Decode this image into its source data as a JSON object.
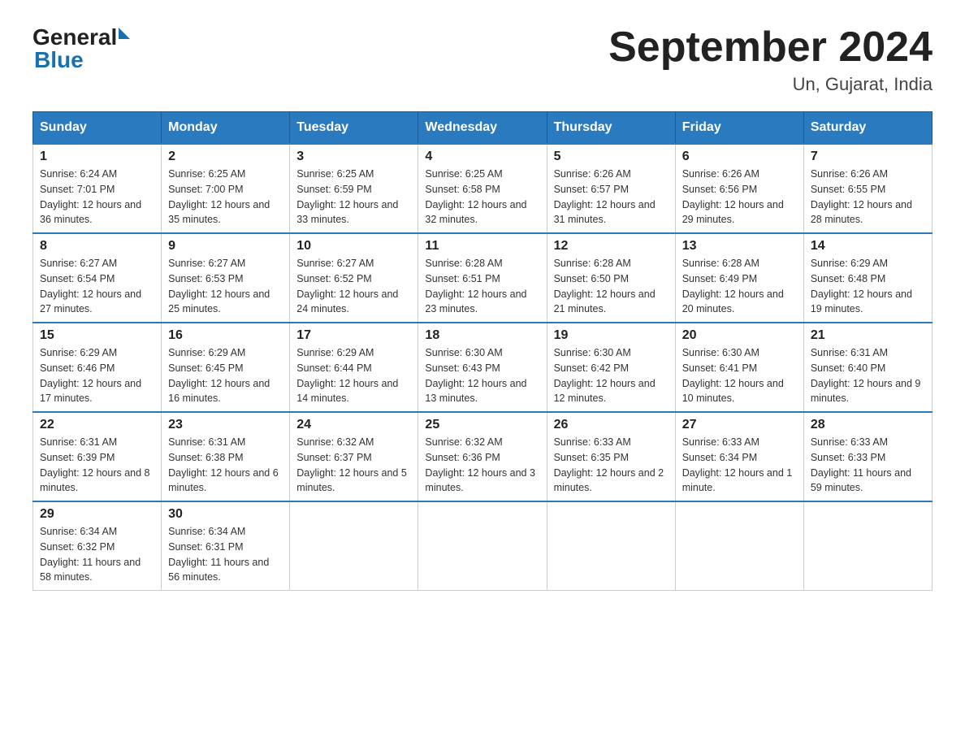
{
  "header": {
    "logo": {
      "text_general": "General",
      "triangle": "▶",
      "text_blue": "Blue"
    },
    "title": "September 2024",
    "location": "Un, Gujarat, India"
  },
  "calendar": {
    "days_of_week": [
      "Sunday",
      "Monday",
      "Tuesday",
      "Wednesday",
      "Thursday",
      "Friday",
      "Saturday"
    ],
    "weeks": [
      [
        {
          "day": "1",
          "sunrise": "6:24 AM",
          "sunset": "7:01 PM",
          "daylight": "12 hours and 36 minutes."
        },
        {
          "day": "2",
          "sunrise": "6:25 AM",
          "sunset": "7:00 PM",
          "daylight": "12 hours and 35 minutes."
        },
        {
          "day": "3",
          "sunrise": "6:25 AM",
          "sunset": "6:59 PM",
          "daylight": "12 hours and 33 minutes."
        },
        {
          "day": "4",
          "sunrise": "6:25 AM",
          "sunset": "6:58 PM",
          "daylight": "12 hours and 32 minutes."
        },
        {
          "day": "5",
          "sunrise": "6:26 AM",
          "sunset": "6:57 PM",
          "daylight": "12 hours and 31 minutes."
        },
        {
          "day": "6",
          "sunrise": "6:26 AM",
          "sunset": "6:56 PM",
          "daylight": "12 hours and 29 minutes."
        },
        {
          "day": "7",
          "sunrise": "6:26 AM",
          "sunset": "6:55 PM",
          "daylight": "12 hours and 28 minutes."
        }
      ],
      [
        {
          "day": "8",
          "sunrise": "6:27 AM",
          "sunset": "6:54 PM",
          "daylight": "12 hours and 27 minutes."
        },
        {
          "day": "9",
          "sunrise": "6:27 AM",
          "sunset": "6:53 PM",
          "daylight": "12 hours and 25 minutes."
        },
        {
          "day": "10",
          "sunrise": "6:27 AM",
          "sunset": "6:52 PM",
          "daylight": "12 hours and 24 minutes."
        },
        {
          "day": "11",
          "sunrise": "6:28 AM",
          "sunset": "6:51 PM",
          "daylight": "12 hours and 23 minutes."
        },
        {
          "day": "12",
          "sunrise": "6:28 AM",
          "sunset": "6:50 PM",
          "daylight": "12 hours and 21 minutes."
        },
        {
          "day": "13",
          "sunrise": "6:28 AM",
          "sunset": "6:49 PM",
          "daylight": "12 hours and 20 minutes."
        },
        {
          "day": "14",
          "sunrise": "6:29 AM",
          "sunset": "6:48 PM",
          "daylight": "12 hours and 19 minutes."
        }
      ],
      [
        {
          "day": "15",
          "sunrise": "6:29 AM",
          "sunset": "6:46 PM",
          "daylight": "12 hours and 17 minutes."
        },
        {
          "day": "16",
          "sunrise": "6:29 AM",
          "sunset": "6:45 PM",
          "daylight": "12 hours and 16 minutes."
        },
        {
          "day": "17",
          "sunrise": "6:29 AM",
          "sunset": "6:44 PM",
          "daylight": "12 hours and 14 minutes."
        },
        {
          "day": "18",
          "sunrise": "6:30 AM",
          "sunset": "6:43 PM",
          "daylight": "12 hours and 13 minutes."
        },
        {
          "day": "19",
          "sunrise": "6:30 AM",
          "sunset": "6:42 PM",
          "daylight": "12 hours and 12 minutes."
        },
        {
          "day": "20",
          "sunrise": "6:30 AM",
          "sunset": "6:41 PM",
          "daylight": "12 hours and 10 minutes."
        },
        {
          "day": "21",
          "sunrise": "6:31 AM",
          "sunset": "6:40 PM",
          "daylight": "12 hours and 9 minutes."
        }
      ],
      [
        {
          "day": "22",
          "sunrise": "6:31 AM",
          "sunset": "6:39 PM",
          "daylight": "12 hours and 8 minutes."
        },
        {
          "day": "23",
          "sunrise": "6:31 AM",
          "sunset": "6:38 PM",
          "daylight": "12 hours and 6 minutes."
        },
        {
          "day": "24",
          "sunrise": "6:32 AM",
          "sunset": "6:37 PM",
          "daylight": "12 hours and 5 minutes."
        },
        {
          "day": "25",
          "sunrise": "6:32 AM",
          "sunset": "6:36 PM",
          "daylight": "12 hours and 3 minutes."
        },
        {
          "day": "26",
          "sunrise": "6:33 AM",
          "sunset": "6:35 PM",
          "daylight": "12 hours and 2 minutes."
        },
        {
          "day": "27",
          "sunrise": "6:33 AM",
          "sunset": "6:34 PM",
          "daylight": "12 hours and 1 minute."
        },
        {
          "day": "28",
          "sunrise": "6:33 AM",
          "sunset": "6:33 PM",
          "daylight": "11 hours and 59 minutes."
        }
      ],
      [
        {
          "day": "29",
          "sunrise": "6:34 AM",
          "sunset": "6:32 PM",
          "daylight": "11 hours and 58 minutes."
        },
        {
          "day": "30",
          "sunrise": "6:34 AM",
          "sunset": "6:31 PM",
          "daylight": "11 hours and 56 minutes."
        },
        null,
        null,
        null,
        null,
        null
      ]
    ]
  }
}
